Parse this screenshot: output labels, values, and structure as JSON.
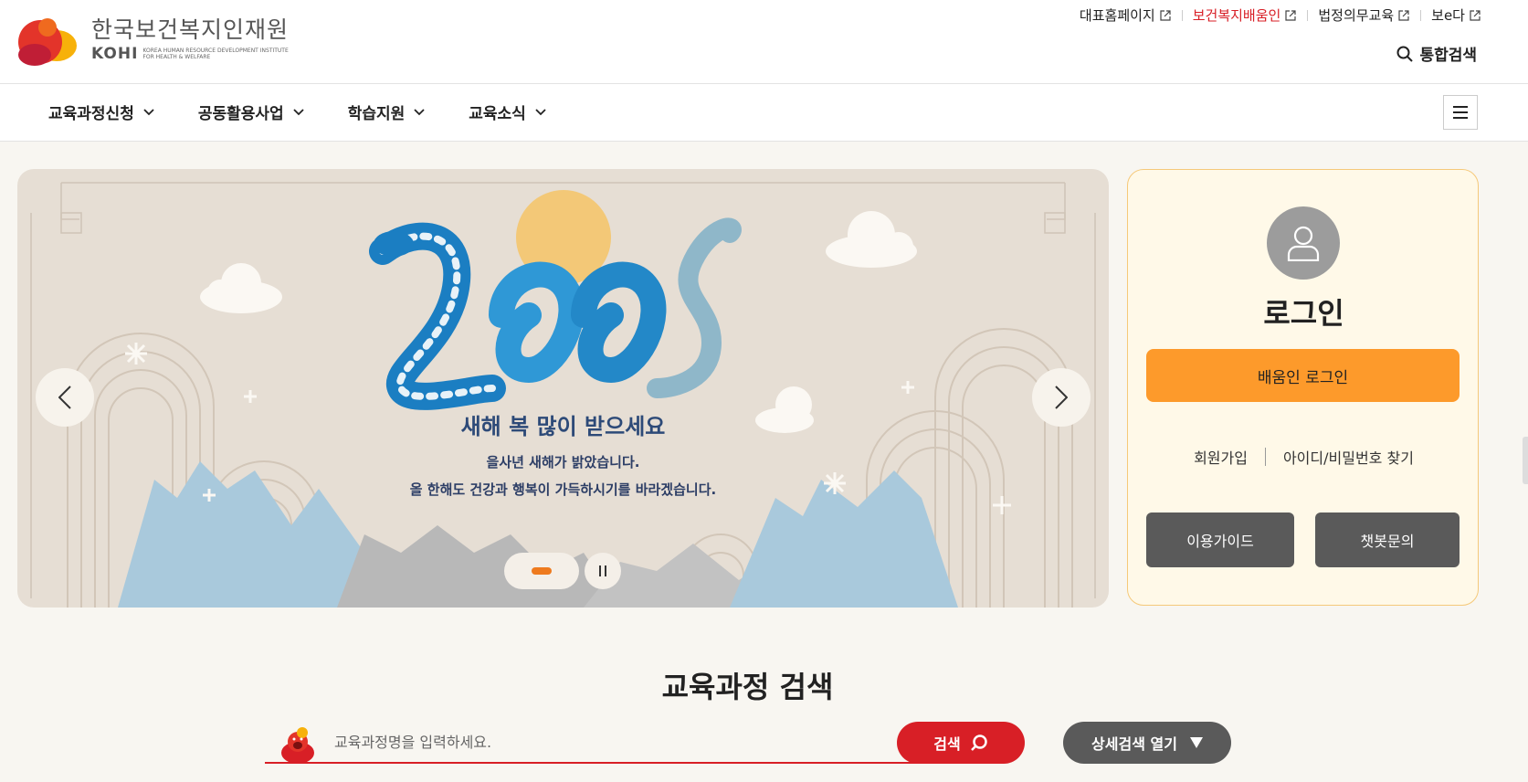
{
  "header": {
    "org_name_kr": "한국보건복지인재원",
    "org_name_short": "KOHI",
    "org_name_en": "KOREA HUMAN RESOURCE DEVELOPMENT INSTITUTE FOR HEALTH & WELFARE",
    "util_links": [
      {
        "label": "대표홈페이지",
        "icon": "external-link-icon"
      },
      {
        "label": "보건복지배움인",
        "icon": "external-link-icon",
        "color": "#d81f26"
      },
      {
        "label": "법정의무교육",
        "icon": "external-link-icon"
      },
      {
        "label": "보e다",
        "icon": "external-link-icon"
      }
    ],
    "unified_search": "통합검색"
  },
  "gnb": {
    "items": [
      "교육과정신청",
      "공동활용사업",
      "학습지원",
      "교육소식"
    ],
    "menu_icon": "hamburger-icon"
  },
  "banner": {
    "year_art": "2025",
    "title": "새해 복 많이 받으세요",
    "line1": "을사년 새해가 밝았습니다.",
    "line2": "올 한해도 건강과 행복이 가득하시기를 바라겠습니다.",
    "prev_icon": "chevron-left-icon",
    "next_icon": "chevron-right-icon",
    "pause_icon": "pause-icon"
  },
  "login": {
    "title": "로그인",
    "login_button": "배움인 로그인",
    "signup": "회원가입",
    "find_account": "아이디/비밀번호 찾기",
    "guide_button": "이용가이드",
    "chatbot_button": "챗봇문의"
  },
  "course_search": {
    "title": "교육과정 검색",
    "placeholder": "교육과정명을 입력하세요.",
    "search_button": "검색",
    "detail_button": "상세검색 열기"
  },
  "colors": {
    "brand_red": "#d81f26",
    "login_orange": "#fd9a2b",
    "banner_bg": "#e6ded4",
    "button_gray": "#5a5a5a"
  }
}
